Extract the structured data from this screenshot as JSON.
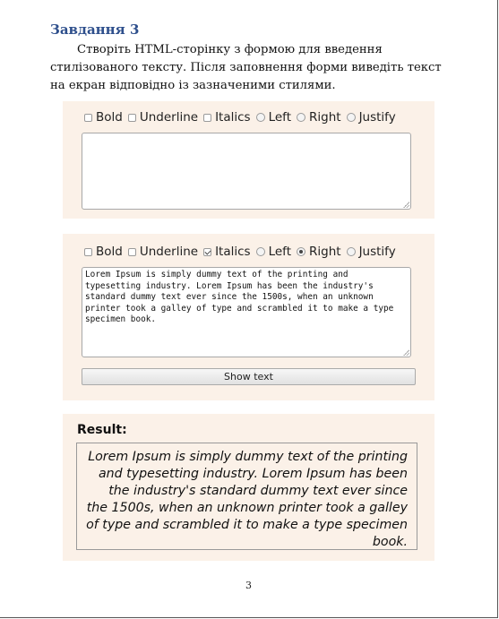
{
  "document": {
    "heading": "Завдання 3",
    "task_text": "Створіть HTML-сторінку з формою для введення стилізованого тексту. Після заповнення форми виведіть текст на екран відповідно із зазначеними стилями.",
    "page_number": "3"
  },
  "form1": {
    "bold_label": "Bold",
    "underline_label": "Underline",
    "italics_label": "Italics",
    "left_label": "Left",
    "right_label": "Right",
    "justify_label": "Justify",
    "textarea_value": ""
  },
  "form2": {
    "bold_label": "Bold",
    "underline_label": "Underline",
    "italics_label": "Italics",
    "left_label": "Left",
    "right_label": "Right",
    "justify_label": "Justify",
    "textarea_value": "Lorem Ipsum is simply dummy text of the printing and typesetting industry. Lorem Ipsum has been the industry's standard dummy text ever since the 1500s, when an unknown printer took a galley of type and scrambled it to make a type specimen book.",
    "show_button_label": "Show text"
  },
  "result": {
    "label": "Result:",
    "text": "Lorem Ipsum is simply dummy text of the printing and typesetting industry. Lorem Ipsum has been the industry's standard dummy text ever since the 1500s, when an unknown printer took a galley of type and scrambled it to make a type specimen book."
  }
}
